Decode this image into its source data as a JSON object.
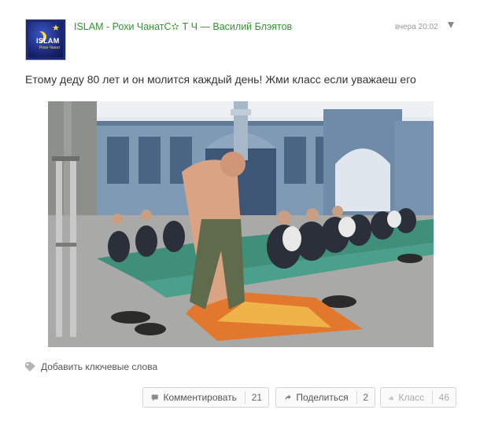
{
  "author": {
    "avatar_text": "ISLAM",
    "avatar_subtext": "Рохи Чанат",
    "header": "ISLAM - Рохи ЧанатС✫ Т Ч — Василий Блэятов"
  },
  "post": {
    "timestamp": "вчера 20:02",
    "text": "Етому деду 80 лет и он молится каждый день! Жми класс если уважаеш его"
  },
  "tags": {
    "label": "Добавить ключевые слова"
  },
  "actions": {
    "comment": {
      "label": "Комментировать",
      "count": "21"
    },
    "share": {
      "label": "Поделиться",
      "count": "2"
    },
    "like": {
      "label": "Класс",
      "count": "46"
    }
  },
  "colors": {
    "link_green": "#2f9430",
    "text": "#333333",
    "muted": "#999999"
  }
}
